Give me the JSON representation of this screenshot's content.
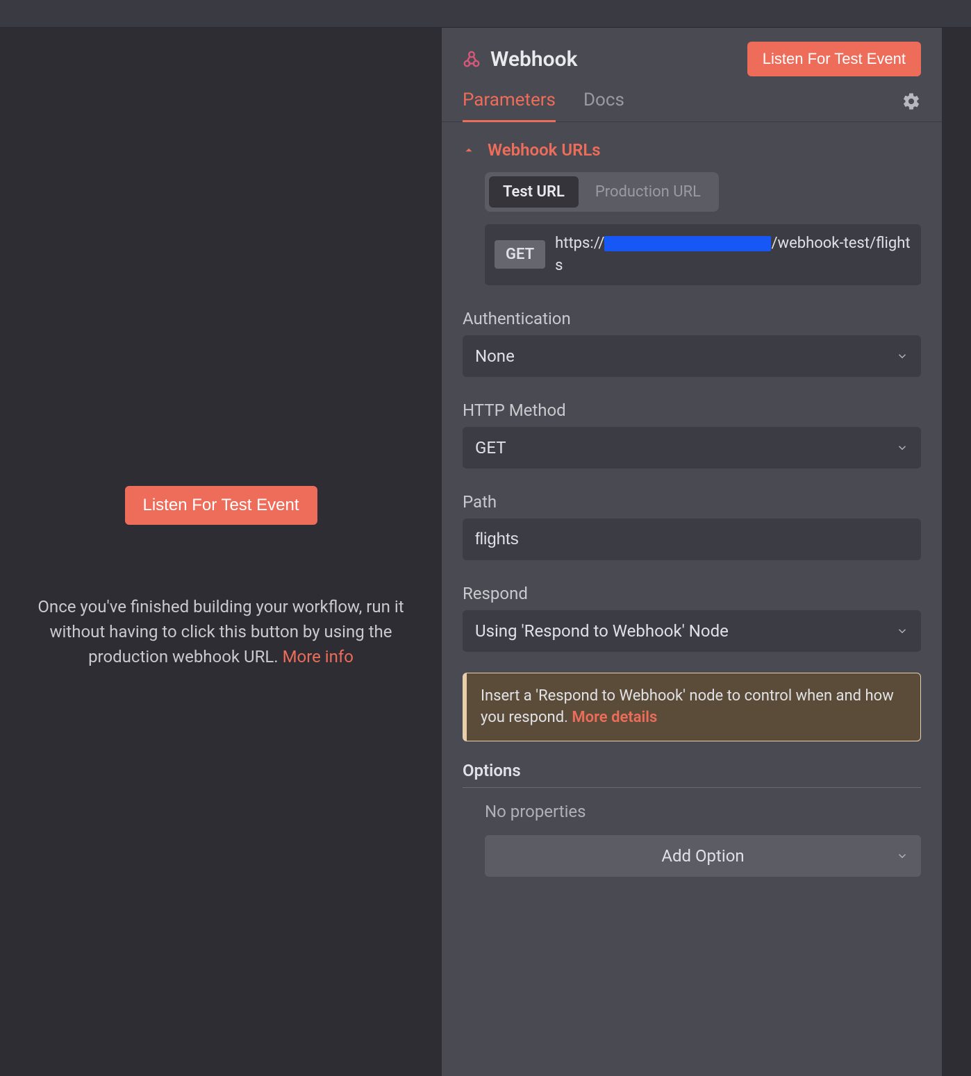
{
  "topBar": {
    "cornerText": ""
  },
  "left": {
    "listenBtn": "Listen For Test Event",
    "description": "Once you've finished building your workflow, run it without having to click this button by using the production webhook URL.  ",
    "moreInfo": "More info"
  },
  "panel": {
    "title": "Webhook",
    "listenBtn": "Listen For Test Event",
    "tabs": {
      "parameters": "Parameters",
      "docs": "Docs"
    },
    "section": {
      "title": "Webhook URLs",
      "pillTabs": {
        "test": "Test URL",
        "prod": "Production URL"
      },
      "methodBadge": "GET",
      "urlPrefix": "https://",
      "urlSuffix": "/webhook-test/flights"
    },
    "fields": {
      "authLabel": "Authentication",
      "authValue": "None",
      "methodLabel": "HTTP Method",
      "methodValue": "GET",
      "pathLabel": "Path",
      "pathValue": "flights",
      "respondLabel": "Respond",
      "respondValue": "Using 'Respond to Webhook' Node"
    },
    "notice": {
      "text": "Insert a 'Respond to Webhook' node to control when and how you respond. ",
      "link": "More details"
    },
    "options": {
      "header": "Options",
      "empty": "No properties",
      "addBtn": "Add Option"
    }
  }
}
